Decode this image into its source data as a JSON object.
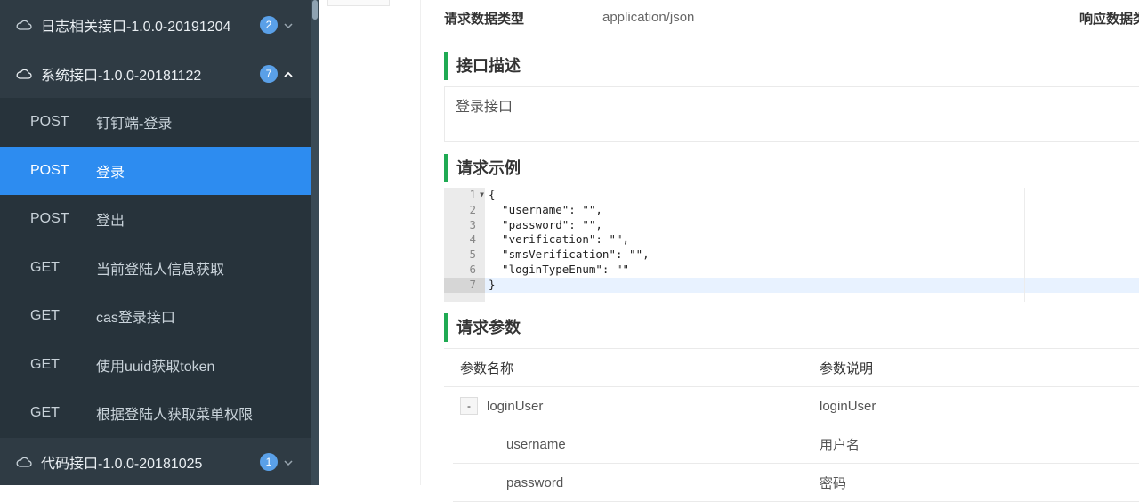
{
  "sidebar": {
    "groups": [
      {
        "label": "日志相关接口-1.0.0-20191204",
        "count": "2",
        "expanded": false
      },
      {
        "label": "系统接口-1.0.0-20181122",
        "count": "7",
        "expanded": true
      },
      {
        "label": "代码接口-1.0.0-20181025",
        "count": "1",
        "expanded": false
      }
    ],
    "items": [
      {
        "method": "POST",
        "label": "钉钉端-登录"
      },
      {
        "method": "POST",
        "label": "登录",
        "active": true
      },
      {
        "method": "POST",
        "label": "登出"
      },
      {
        "method": "GET",
        "label": "当前登陆人信息获取"
      },
      {
        "method": "GET",
        "label": "cas登录接口"
      },
      {
        "method": "GET",
        "label": "使用uuid获取token"
      },
      {
        "method": "GET",
        "label": "根据登陆人获取菜单权限"
      }
    ]
  },
  "content": {
    "request_type_label": "请求数据类型",
    "request_type_value": "application/json",
    "response_type_label": "响应数据类",
    "desc_title": "接口描述",
    "desc_text": "登录接口",
    "example_title": "请求示例",
    "code_lines": [
      "{",
      "  \"username\": \"\",",
      "  \"password\": \"\",",
      "  \"verification\": \"\",",
      "  \"smsVerification\": \"\",",
      "  \"loginTypeEnum\": \"\"",
      "}"
    ],
    "line_numbers": [
      "1",
      "2",
      "3",
      "4",
      "5",
      "6",
      "7"
    ],
    "params_title": "请求参数",
    "params_headers": [
      "参数名称",
      "参数说明"
    ],
    "params_rows": [
      {
        "name": "loginUser",
        "desc": "loginUser",
        "toggle": "-"
      },
      {
        "name": "username",
        "desc": "用户名"
      },
      {
        "name": "password",
        "desc": "密码"
      }
    ]
  },
  "colors": {
    "sidebar_bg": "#2f3b44",
    "active": "#2d8cf0",
    "accent_green": "#1faa53",
    "badge": "#5aa0e8"
  }
}
